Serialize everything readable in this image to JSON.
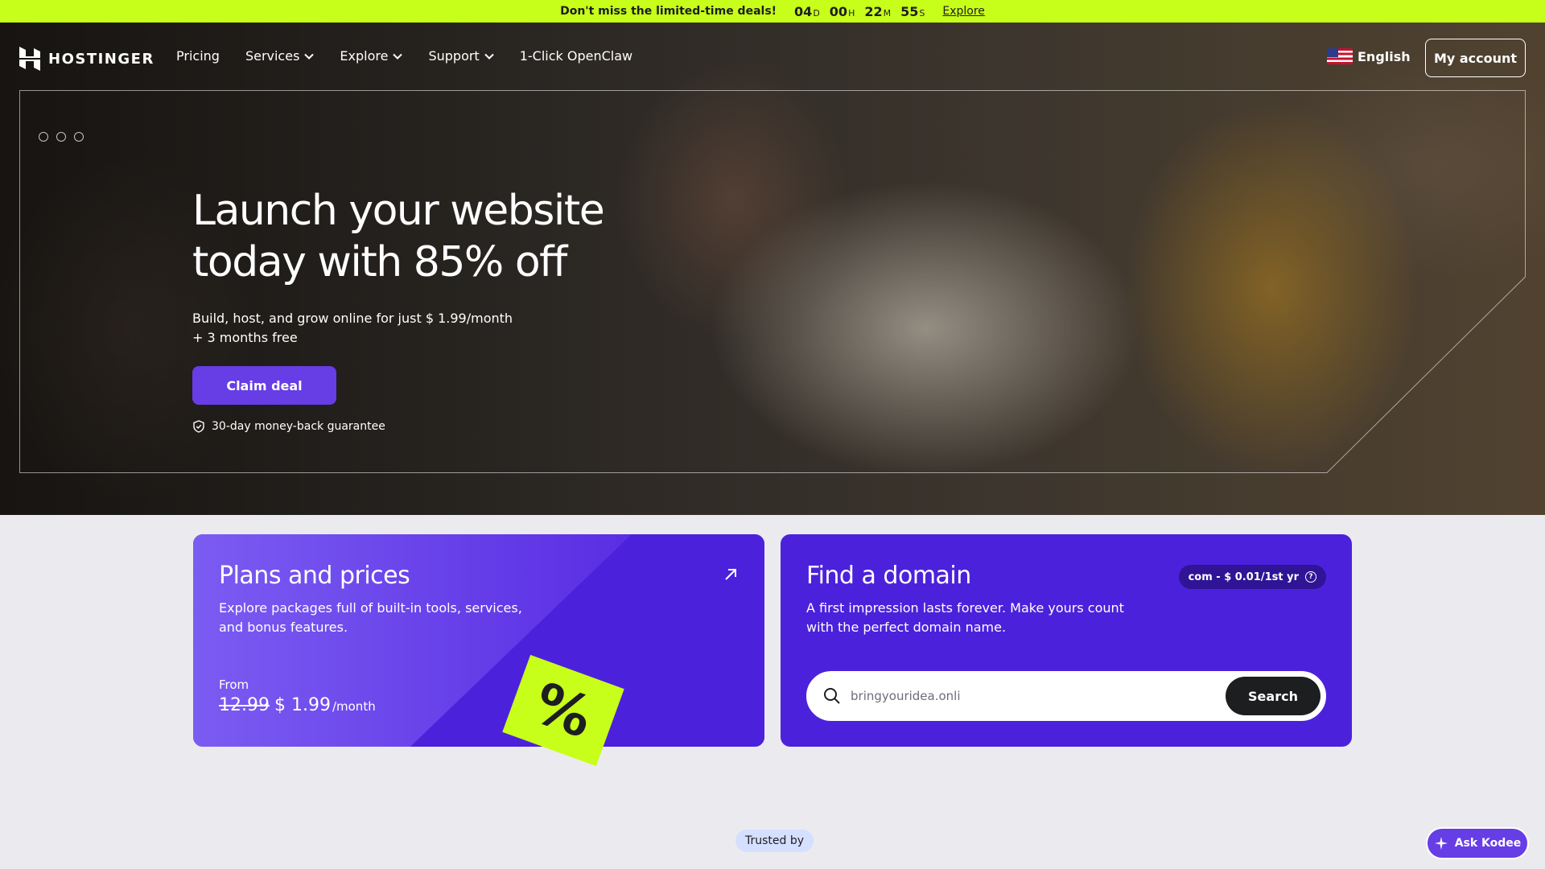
{
  "promo": {
    "message": "Don't miss the limited-time deals!",
    "countdown": [
      {
        "value": "04",
        "unit": "D"
      },
      {
        "value": "00",
        "unit": "H"
      },
      {
        "value": "22",
        "unit": "M"
      },
      {
        "value": "55",
        "unit": "S"
      }
    ],
    "link": "Explore"
  },
  "header": {
    "brand": "HOSTINGER",
    "nav": [
      {
        "label": "Pricing",
        "dropdown": false
      },
      {
        "label": "Services",
        "dropdown": true
      },
      {
        "label": "Explore",
        "dropdown": true
      },
      {
        "label": "Support",
        "dropdown": true
      },
      {
        "label": "1-Click OpenClaw",
        "dropdown": false
      }
    ],
    "language": "English",
    "account": "My account"
  },
  "hero": {
    "title": "Launch your website today with 85% off",
    "subtitle": "Build, host, and grow online for just $ 1.99/month + 3 months free",
    "cta": "Claim deal",
    "guarantee": "30-day money-back guarantee"
  },
  "plans_card": {
    "title": "Plans and prices",
    "description": "Explore packages full of built-in tools, services, and bonus features.",
    "from_label": "From",
    "old_price": "12.99",
    "new_price": "$ 1.99",
    "period": "/month",
    "tag_symbol": "%"
  },
  "domain_card": {
    "title": "Find a domain",
    "badge": "com - $ 0.01/1st yr",
    "description": "A first impression lasts forever. Make yours count with the perfect domain name.",
    "search_value": "bringyouridea.onli",
    "search_button": "Search"
  },
  "trusted": "Trusted by",
  "kodee": "Ask Kodee",
  "colors": {
    "promo_bg": "#c8ff1a",
    "brand_purple": "#673de6",
    "card_purple": "#4c21db",
    "dark": "#1d1e20"
  }
}
